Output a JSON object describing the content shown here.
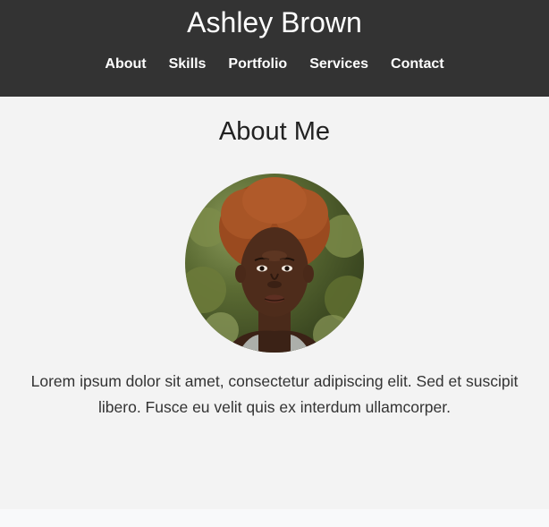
{
  "header": {
    "title": "Ashley Brown",
    "nav": {
      "about": "About",
      "skills": "Skills",
      "portfolio": "Portfolio",
      "services": "Services",
      "contact": "Contact"
    }
  },
  "about": {
    "heading": "About Me",
    "bio": "Lorem ipsum dolor sit amet, consectetur adipiscing elit. Sed et suscipit libero. Fusce eu velit quis ex interdum ullamcorper."
  },
  "colors": {
    "header_bg": "#333333",
    "section_bg": "#f3f3f3",
    "page_bg": "#f8f9fa"
  }
}
